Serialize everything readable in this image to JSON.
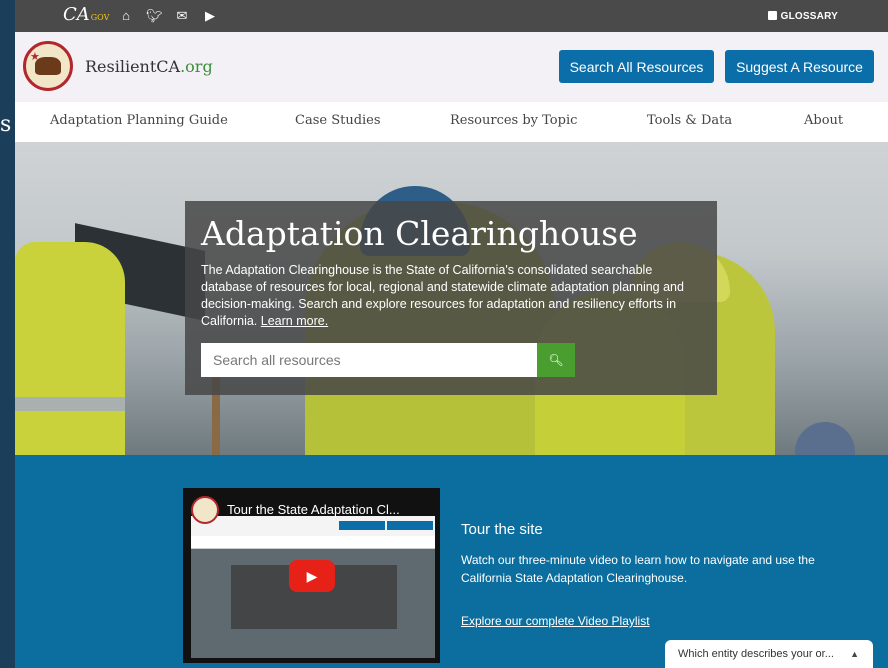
{
  "topbar": {
    "ca_logo": "CA",
    "ca_gov": "GOV",
    "icons": [
      "home-icon",
      "twitter-icon",
      "email-icon",
      "youtube-icon"
    ],
    "glossary": "GLOSSARY"
  },
  "header": {
    "brand_main": "ResilientCA",
    "brand_tld": ".org",
    "search_all_label": "Search All Resources",
    "suggest_label": "Suggest A Resource"
  },
  "nav": {
    "items": [
      "Adaptation Planning Guide",
      "Case Studies",
      "Resources by Topic",
      "Tools & Data",
      "About"
    ]
  },
  "hero": {
    "title": "Adaptation Clearinghouse",
    "description": "The Adaptation Clearinghouse is the State of California's consolidated searchable database of resources for local, regional and statewide climate adaptation planning and decision-making. Search and explore resources for adaptation and resiliency efforts in California.",
    "learn_more": "Learn more.",
    "search_placeholder": "Search all resources"
  },
  "tour": {
    "video_title": "Tour the State Adaptation Cl...",
    "title": "Tour the site",
    "description": "Watch our three-minute video to learn how to navigate and use the California State Adaptation Clearinghouse.",
    "playlist_link": "Explore our complete Video Playlist"
  },
  "survey": {
    "label": "Which entity describes your or..."
  },
  "colors": {
    "brand_blue": "#0b6ea8",
    "section_blue": "#0b6e9e",
    "search_green": "#4a9e2f",
    "topbar": "#4a4a4a"
  }
}
